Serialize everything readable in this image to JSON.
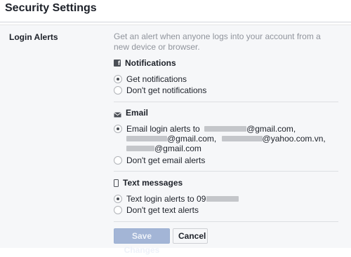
{
  "page": {
    "title": "Security Settings"
  },
  "login_alerts": {
    "label": "Login Alerts",
    "description": "Get an alert when anyone logs into your account from a new device or browser.",
    "notifications": {
      "heading": "Notifications",
      "icon": "facebook-icon",
      "options": [
        "Get notifications",
        "Don't get notifications"
      ],
      "selected": 0
    },
    "email": {
      "heading": "Email",
      "icon": "envelope-icon",
      "option_prefix": "Email login alerts to",
      "addresses": [
        "@gmail.com,",
        "@gmail.com,",
        "@yahoo.com.vn,",
        "@gmail.com"
      ],
      "other_option": "Don't get email alerts",
      "selected": 0
    },
    "text_messages": {
      "heading": "Text messages",
      "icon": "phone-icon",
      "option_prefix": "Text login alerts to 09",
      "other_option": "Don't get text alerts",
      "selected": 0
    }
  },
  "actions": {
    "save_label": "Save Changes",
    "cancel_label": "Cancel"
  },
  "colors": {
    "accent_disabled": "#a3b5d6",
    "panel_bg": "#f6f7f9",
    "muted_text": "#90949c"
  }
}
